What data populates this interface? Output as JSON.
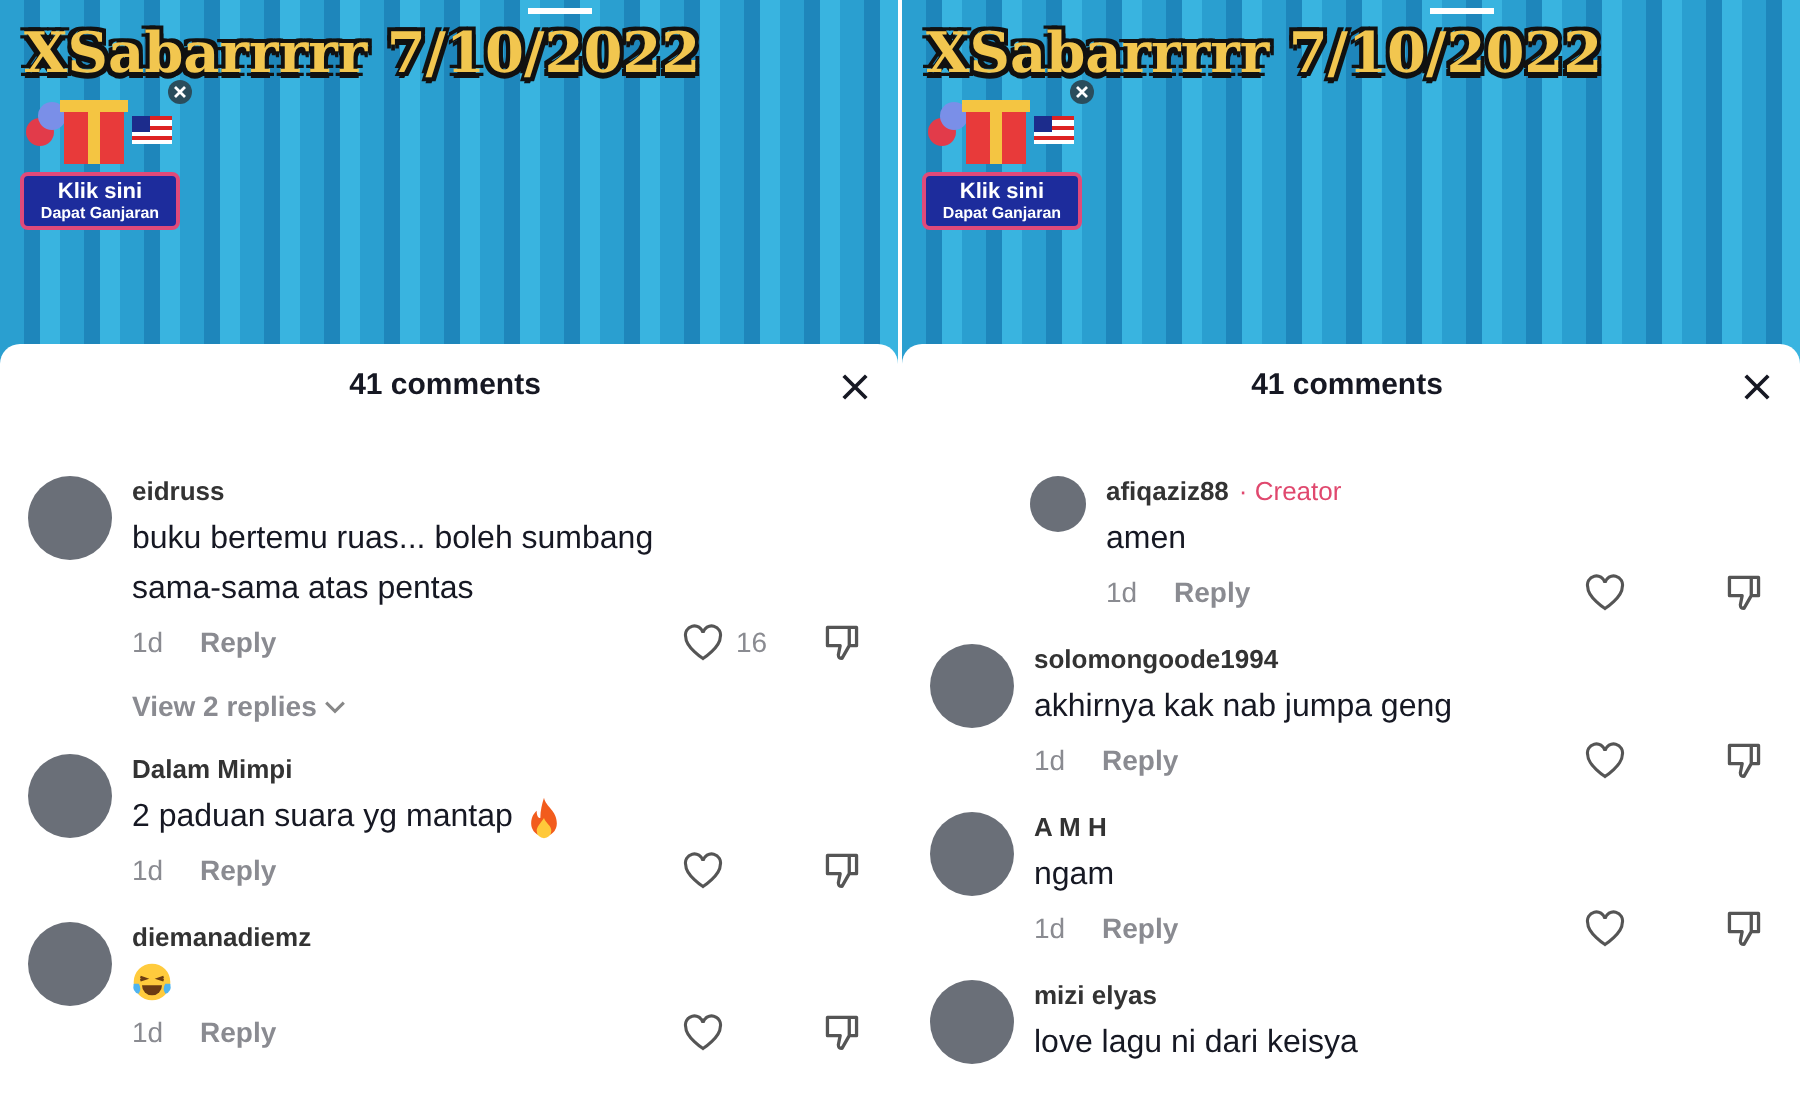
{
  "panels": [
    {
      "video": {
        "title": "XSabarrrrr 7/10/2022",
        "promo": {
          "line1": "Klik sini",
          "line2": "Dapat Ganjaran"
        }
      },
      "sheet": {
        "title": "41 comments",
        "comments": [
          {
            "user": "eidruss",
            "kind": "plain",
            "nested": false,
            "text": "buku bertemu ruas... boleh sumbang sama-sama atas pentas",
            "age": "1d",
            "reply": "Reply",
            "likes": "16",
            "view_replies": "View 2 replies"
          },
          {
            "user": "Dalam Mimpi",
            "nested": false,
            "text": "2 paduan suara yg mantap",
            "kind": "fire",
            "age": "1d",
            "reply": "Reply"
          },
          {
            "user": "diemanadiemz",
            "nested": false,
            "kind": "laughing",
            "age": "1d",
            "reply": "Reply"
          }
        ]
      }
    },
    {
      "video": {
        "title": "XSabarrrrr 7/10/2022",
        "promo": {
          "line1": "Klik sini",
          "line2": "Dapat Ganjaran"
        }
      },
      "sheet": {
        "title": "41 comments",
        "comments": [
          {
            "user": "afiqaziz88",
            "badge": "· Creator",
            "kind": "plain",
            "nested": true,
            "text": "amen",
            "age": "1d",
            "reply": "Reply"
          },
          {
            "user": "solomongoode1994",
            "kind": "plain",
            "nested": false,
            "text": "akhirnya kak nab jumpa geng",
            "age": "1d",
            "reply": "Reply"
          },
          {
            "user": "A M H",
            "kind": "plain",
            "nested": false,
            "text": "ngam",
            "age": "1d",
            "reply": "Reply"
          },
          {
            "user": "mizi elyas",
            "kind": "plain",
            "nested": false,
            "text": "love lagu ni dari keisya"
          }
        ]
      }
    }
  ]
}
